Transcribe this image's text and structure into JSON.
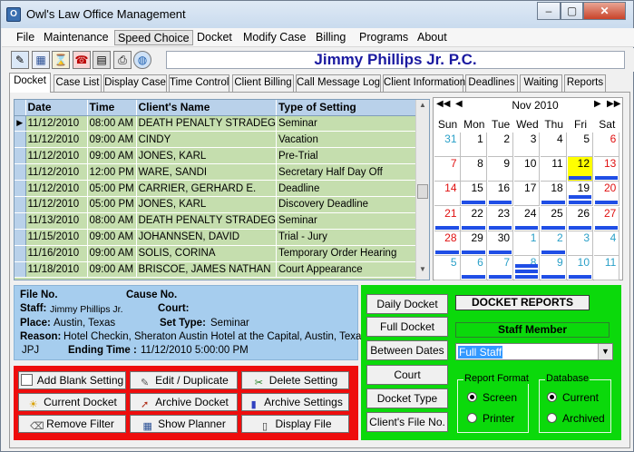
{
  "window": {
    "title": "Owl's Law Office Management",
    "min": "–",
    "max": "▢",
    "close": "✕"
  },
  "menu": [
    "File",
    "Maintenance",
    "Speed Choice",
    "Docket",
    "Modify Case",
    "Billing",
    "Programs",
    "About"
  ],
  "toolbar_icons": [
    "edit-icon",
    "calendar-icon",
    "hourglass-icon",
    "phone-icon",
    "calculator-icon",
    "print-icon",
    "globe-icon"
  ],
  "firm_name": "Jimmy Phillips Jr. P.C.",
  "tabs": [
    "Docket",
    "Case List",
    "Display Case",
    "Time Control",
    "Client Billing",
    "Call Message Log",
    "Client Information",
    "Deadlines",
    "Waiting",
    "Reports"
  ],
  "grid": {
    "columns": [
      "Date",
      "Time",
      "Client's Name",
      "Type of Setting"
    ],
    "rows": [
      [
        "11/12/2010",
        "08:00 AM",
        "DEATH PENALTY STRADEG",
        "Seminar"
      ],
      [
        "11/12/2010",
        "09:00 AM",
        "CINDY",
        "Vacation"
      ],
      [
        "11/12/2010",
        "09:00 AM",
        "JONES, KARL",
        "Pre-Trial"
      ],
      [
        "11/12/2010",
        "12:00 PM",
        "WARE, SANDI",
        "Secretary Half Day Off"
      ],
      [
        "11/12/2010",
        "05:00 PM",
        "CARRIER, GERHARD E.",
        "Deadline"
      ],
      [
        "11/12/2010",
        "05:00 PM",
        "JONES, KARL",
        "Discovery Deadline"
      ],
      [
        "11/13/2010",
        "08:00 AM",
        "DEATH PENALTY STRADEG",
        "Seminar"
      ],
      [
        "11/15/2010",
        "09:00 AM",
        "JOHANNSEN, DAVID",
        "Trial - Jury"
      ],
      [
        "11/16/2010",
        "09:00 AM",
        "SOLIS, CORINA",
        "Temporary Order Hearing"
      ],
      [
        "11/18/2010",
        "09:00 AM",
        "BRISCOE, JAMES NATHAN",
        "Court Appearance"
      ]
    ]
  },
  "calendar": {
    "month": "Nov 2010",
    "nav": {
      "first": "◀◀",
      "prev": "◀",
      "next": "▶",
      "last": "▶▶"
    },
    "days": [
      "Sun",
      "Mon",
      "Tue",
      "Wed",
      "Thu",
      "Fri",
      "Sat"
    ],
    "weeks": [
      [
        {
          "d": "31",
          "c": "#2aa0c8",
          "b": 0
        },
        {
          "d": "1",
          "c": "#000",
          "b": 0
        },
        {
          "d": "2",
          "c": "#000",
          "b": 0
        },
        {
          "d": "3",
          "c": "#000",
          "b": 0
        },
        {
          "d": "4",
          "c": "#000",
          "b": 0
        },
        {
          "d": "5",
          "c": "#000",
          "b": 0
        },
        {
          "d": "6",
          "c": "#e01010",
          "b": 0
        }
      ],
      [
        {
          "d": "7",
          "c": "#e01010",
          "b": 0
        },
        {
          "d": "8",
          "c": "#000",
          "b": 0
        },
        {
          "d": "9",
          "c": "#000",
          "b": 0
        },
        {
          "d": "10",
          "c": "#000",
          "b": 0
        },
        {
          "d": "11",
          "c": "#000",
          "b": 0
        },
        {
          "d": "12",
          "c": "#000",
          "b": 1,
          "today": true
        },
        {
          "d": "13",
          "c": "#e01010",
          "b": 1
        }
      ],
      [
        {
          "d": "14",
          "c": "#e01010",
          "b": 0
        },
        {
          "d": "15",
          "c": "#000",
          "b": 1
        },
        {
          "d": "16",
          "c": "#000",
          "b": 1
        },
        {
          "d": "17",
          "c": "#000",
          "b": 0
        },
        {
          "d": "18",
          "c": "#000",
          "b": 1
        },
        {
          "d": "19",
          "c": "#000",
          "b": 2
        },
        {
          "d": "20",
          "c": "#e01010",
          "b": 1
        }
      ],
      [
        {
          "d": "21",
          "c": "#e01010",
          "b": 1
        },
        {
          "d": "22",
          "c": "#000",
          "b": 1
        },
        {
          "d": "23",
          "c": "#000",
          "b": 1
        },
        {
          "d": "24",
          "c": "#000",
          "b": 1
        },
        {
          "d": "25",
          "c": "#000",
          "b": 1
        },
        {
          "d": "26",
          "c": "#000",
          "b": 1
        },
        {
          "d": "27",
          "c": "#e01010",
          "b": 1
        }
      ],
      [
        {
          "d": "28",
          "c": "#e01010",
          "b": 1
        },
        {
          "d": "29",
          "c": "#000",
          "b": 1
        },
        {
          "d": "30",
          "c": "#000",
          "b": 1
        },
        {
          "d": "1",
          "c": "#2aa0c8",
          "b": 0
        },
        {
          "d": "2",
          "c": "#2aa0c8",
          "b": 1
        },
        {
          "d": "3",
          "c": "#2aa0c8",
          "b": 0
        },
        {
          "d": "4",
          "c": "#2aa0c8",
          "b": 0
        }
      ],
      [
        {
          "d": "5",
          "c": "#2aa0c8",
          "b": 0
        },
        {
          "d": "6",
          "c": "#2aa0c8",
          "b": 1
        },
        {
          "d": "7",
          "c": "#2aa0c8",
          "b": 1
        },
        {
          "d": "8",
          "c": "#2aa0c8",
          "b": 3
        },
        {
          "d": "9",
          "c": "#2aa0c8",
          "b": 1
        },
        {
          "d": "10",
          "c": "#2aa0c8",
          "b": 1
        },
        {
          "d": "11",
          "c": "#2aa0c8",
          "b": 0
        }
      ]
    ]
  },
  "info": {
    "file_no_label": "File No.",
    "cause_no_label": "Cause No.",
    "staff_label": "Staff:",
    "staff_value": "Jimmy Phillips Jr.",
    "court_label": "Court:",
    "place_label": "Place:",
    "place_value": "Austin, Texas",
    "set_type_label": "Set Type:",
    "set_type_value": "Seminar",
    "reason_label": "Reason:",
    "reason_value": "Hotel Checkin, Sheraton Austin Hotel at the Capital, Austin, Texas",
    "initials": "JPJ",
    "ending_label": "Ending Time :",
    "ending_value": "11/12/2010 5:00:00 PM"
  },
  "action_buttons": [
    {
      "label": "Add Blank Setting",
      "icon": "document-icon"
    },
    {
      "label": "Edit / Duplicate",
      "icon": "edit-icon"
    },
    {
      "label": "Delete Setting",
      "icon": "delete-icon"
    },
    {
      "label": "Current Docket",
      "icon": "sun-icon"
    },
    {
      "label": "Archive Docket",
      "icon": "archive-icon"
    },
    {
      "label": "Archive Settings",
      "icon": "chart-icon"
    },
    {
      "label": "Remove Filter",
      "icon": "filter-icon"
    },
    {
      "label": "Show Planner",
      "icon": "calendar-icon"
    },
    {
      "label": "Display File",
      "icon": "file-icon"
    }
  ],
  "reports": {
    "buttons": [
      "Daily Docket",
      "Full Docket",
      "Between Dates",
      "Court",
      "Docket Type",
      "Client's File No."
    ],
    "title": "DOCKET REPORTS",
    "staff_title": "Staff Member",
    "staff_select": "Full Staff",
    "report_format": {
      "caption": "Report Format",
      "options": [
        "Screen",
        "Printer"
      ],
      "selected": "Screen"
    },
    "database": {
      "caption": "Database",
      "options": [
        "Current",
        "Archived"
      ],
      "selected": "Current"
    }
  }
}
